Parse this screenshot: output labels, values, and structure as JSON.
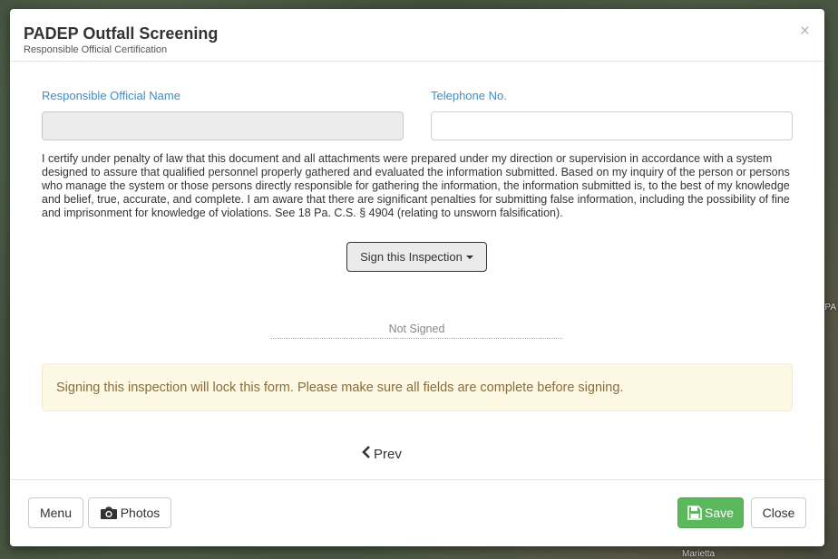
{
  "background": {
    "map_labels": [
      "PA",
      "Marietta"
    ]
  },
  "modal": {
    "title": "PADEP Outfall Screening",
    "subtitle": "Responsible Official Certification",
    "close_glyph": "×"
  },
  "form": {
    "official_name_label": "Responsible Official Name",
    "official_name_value": "",
    "telephone_label": "Telephone No.",
    "telephone_value": "",
    "certification_text": "I certify under penalty of law that this document and all attachments were prepared under my direction or supervision in accordance with a system designed to assure that qualified personnel properly gathered and evaluated the information submitted. Based on my inquiry of the person or persons who manage the system or those persons directly responsible for gathering the information, the information submitted is, to the best of my knowledge and belief, true, accurate, and complete. I am aware that there are significant penalties for submitting false information, including the possibility of fine and imprisonment for knowledge of violations. See 18 Pa. C.S. § 4904 (relating to unsworn falsification).",
    "sign_button_label": "Sign this Inspection",
    "signature_status": "Not Signed",
    "warning_text": "Signing this inspection will lock this form. Please make sure all fields are complete before signing.",
    "prev_label": "Prev"
  },
  "footer": {
    "menu_label": "Menu",
    "photos_label": "Photos",
    "save_label": "Save",
    "close_label": "Close"
  },
  "icons": {
    "camera": "camera-icon",
    "save": "floppy-disk-icon",
    "prev": "chevron-left-icon",
    "dropdown": "caret-down-icon"
  },
  "colors": {
    "label_blue": "#3a8ec9",
    "save_green": "#5cb85c",
    "warning_bg": "#fcf8e3",
    "warning_text": "#8a6d3b"
  }
}
